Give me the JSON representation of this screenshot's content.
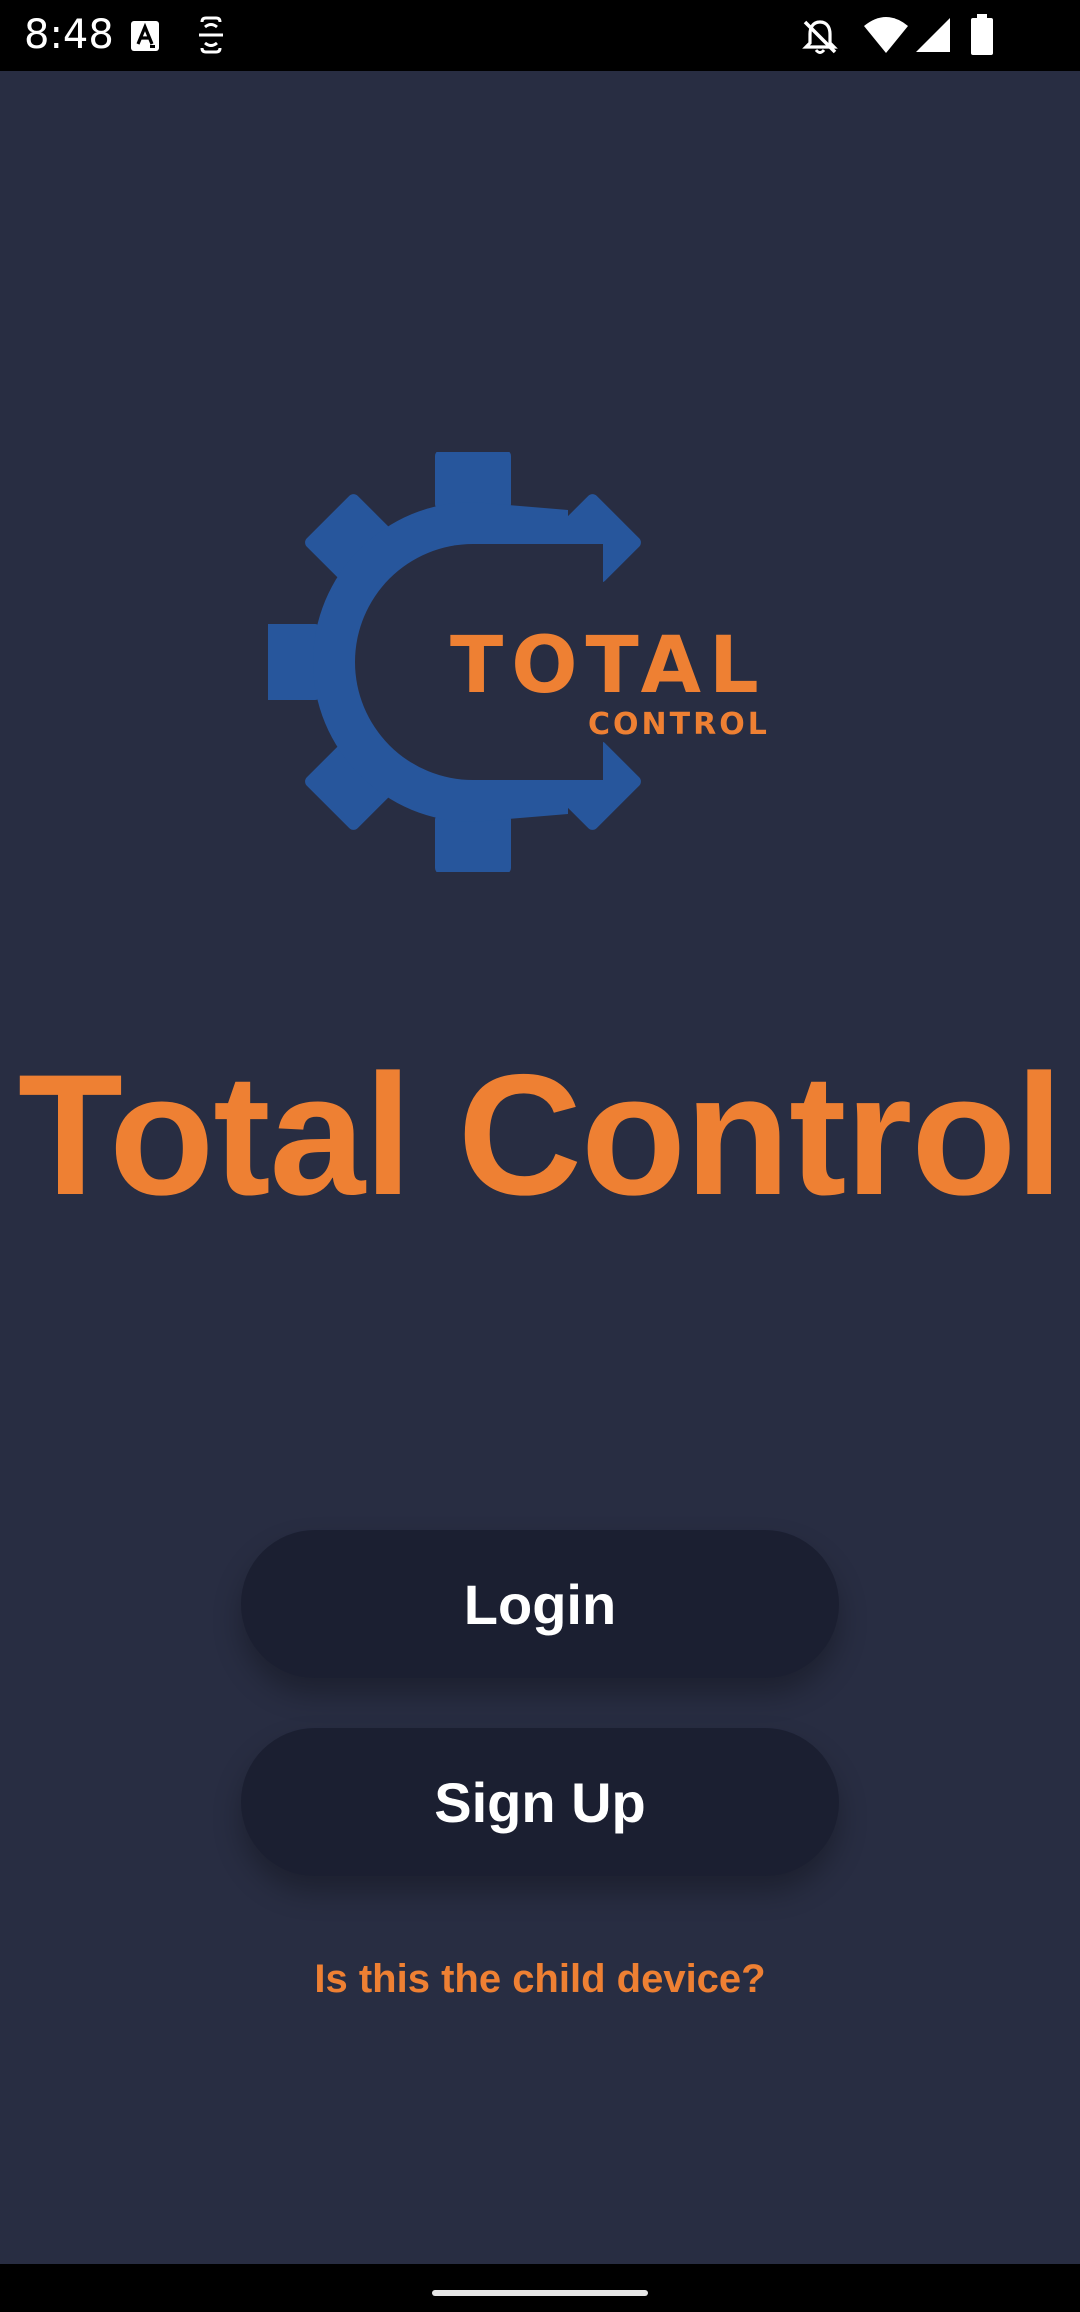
{
  "status_bar": {
    "time": "8:48",
    "left_icons": [
      "keyboard-a-icon",
      "face-scan-icon"
    ],
    "right_icons": [
      "notifications-off-icon",
      "wifi-icon",
      "cellular-signal-icon",
      "battery-icon"
    ]
  },
  "logo": {
    "word": "TOTAL",
    "subword": "CONTROL",
    "gear_color": "#27569c",
    "text_color": "#ee8033"
  },
  "app": {
    "title": "Total Control"
  },
  "buttons": {
    "login_label": "Login",
    "signup_label": "Sign Up"
  },
  "child_link": {
    "text": "Is this the child device?"
  },
  "colors": {
    "background": "#282d42",
    "accent": "#ee8033",
    "button_bg": "#1b1f31",
    "button_text": "#ffffff"
  }
}
